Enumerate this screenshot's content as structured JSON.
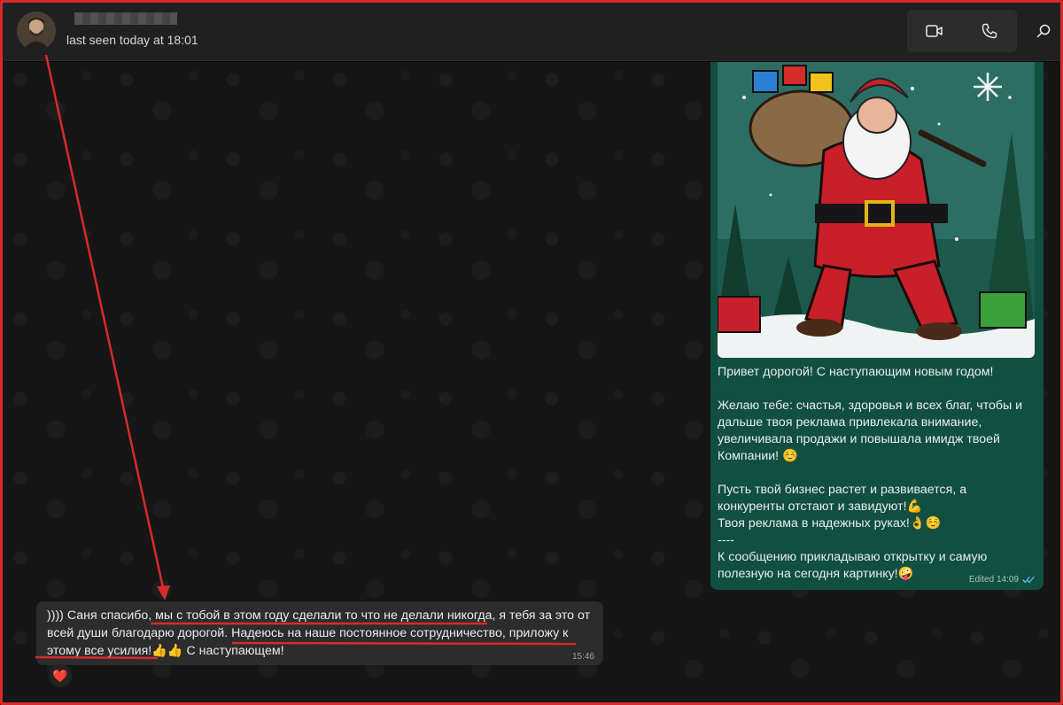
{
  "header": {
    "last_seen": "last seen today at 18:01"
  },
  "icons": {
    "video": "video-camera-icon",
    "call": "phone-icon",
    "search": "search-icon",
    "read": "double-check-icon",
    "reaction": "red-heart"
  },
  "outgoing": {
    "paragraphs": [
      "Привет дорогой! С наступающим новым годом!",
      "Желаю тебе: счастья, здоровья и всех благ, чтобы и дальше твоя реклама привлекала внимание, увеличивала продажи и повышала имидж твоей Компании! ☺️",
      "Пусть твой бизнес растет и развивается, а конкуренты отстают и завидуют!💪\nТвоя реклама в надежных руках!👌☺️\n----\nК сообщению прикладываю открытку и самую полезную на сегодня картинку!🤪"
    ],
    "meta": "Edited 14:09"
  },
  "incoming": {
    "text": ")))) Саня спасибо, мы с тобой в этом году сделали то что не делали никогда, я тебя за это от всей души благодарю дорогой. Надеюсь на наше постоянное сотрудничество, приложу к этому все усилия!👍👍 С наступающем!",
    "time": "15:46",
    "reaction": "❤️"
  },
  "colors": {
    "annotation": "#d62b2b",
    "outgoing_bubble": "#114f41",
    "incoming_bubble": "#2c2c2c",
    "read_ticks": "#53bdeb"
  }
}
